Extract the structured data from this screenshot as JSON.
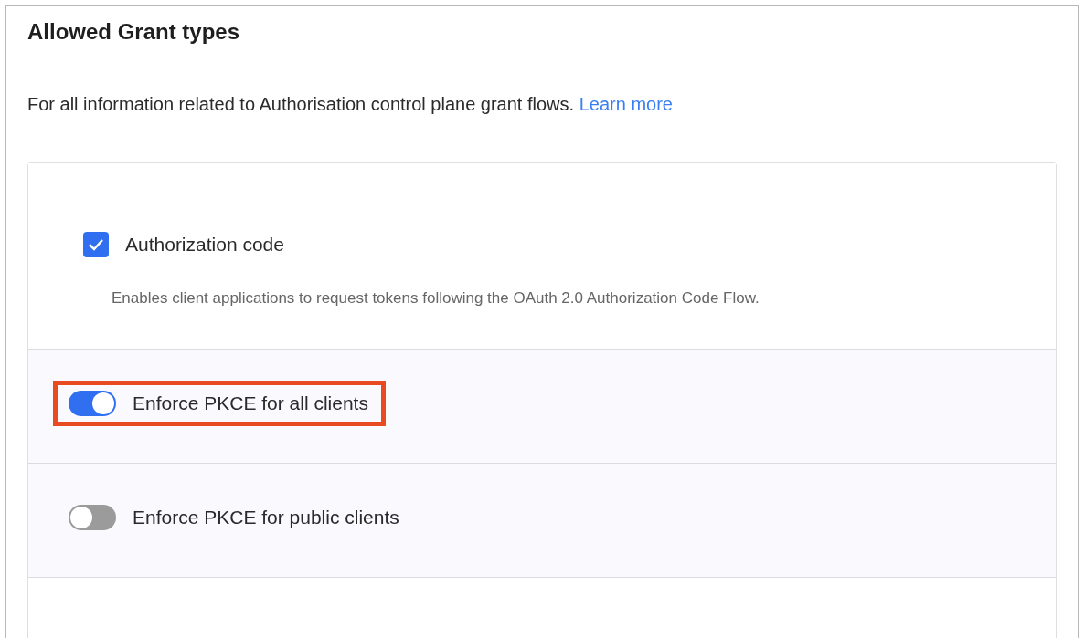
{
  "section": {
    "title": "Allowed Grant types",
    "description": "For all information related to Authorisation control plane grant flows.",
    "link": "Learn more"
  },
  "options": [
    {
      "kind": "checkbox",
      "label": "Authorization code",
      "checked": true,
      "description": "Enables client applications to request tokens following the OAuth 2.0 Authorization Code Flow.",
      "highlighted": false
    },
    {
      "kind": "toggle",
      "label": "Enforce PKCE for all clients",
      "on": true,
      "highlighted": true
    },
    {
      "kind": "toggle",
      "label": "Enforce PKCE for public clients",
      "on": false,
      "highlighted": false
    }
  ]
}
